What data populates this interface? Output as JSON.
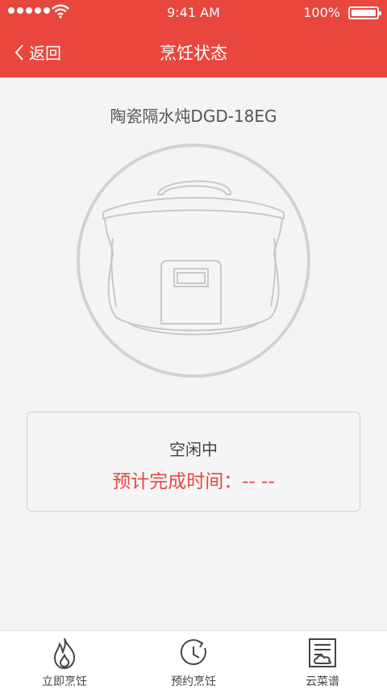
{
  "status_bar": {
    "time": "9:41 AM",
    "battery": "100%"
  },
  "header": {
    "back_label": "返回",
    "title": "烹饪状态"
  },
  "device": {
    "name": "陶瓷隔水炖DGD-18EG"
  },
  "status": {
    "state": "空闲中",
    "eta": "预计完成时间：-- --"
  },
  "tabs": [
    {
      "label": "立即烹饪",
      "icon": "flame-icon"
    },
    {
      "label": "预约烹饪",
      "icon": "clock-icon"
    },
    {
      "label": "云菜谱",
      "icon": "cloud-recipe-icon"
    }
  ],
  "colors": {
    "accent": "#e9473e"
  }
}
